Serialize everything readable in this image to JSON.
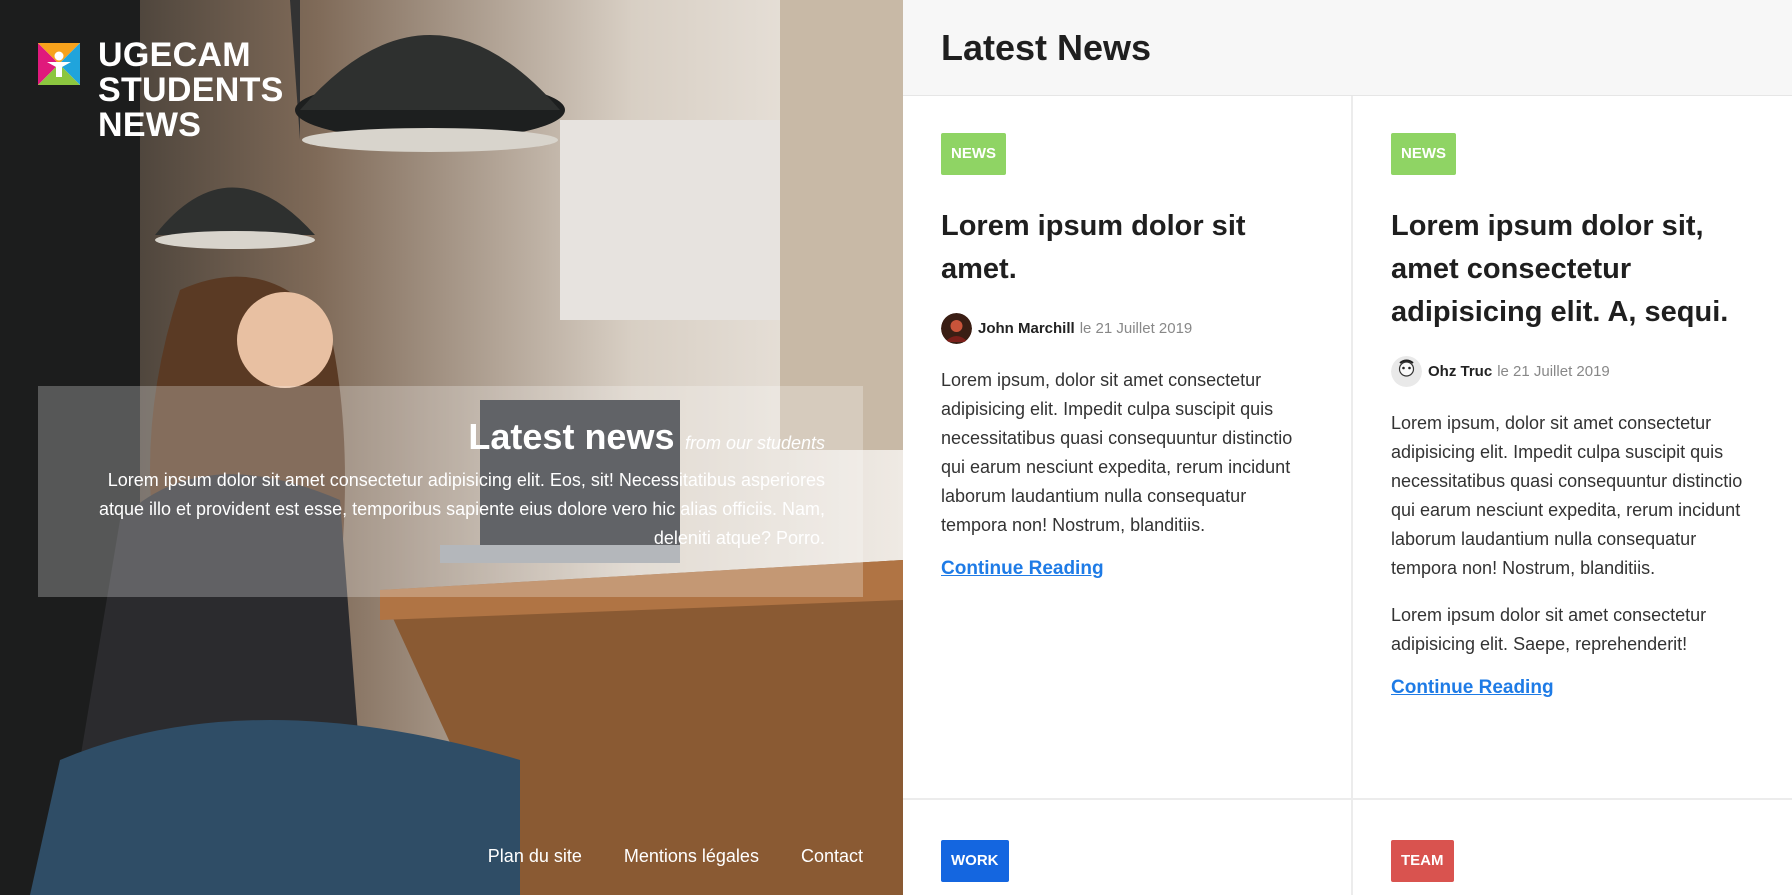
{
  "brand": {
    "lines": [
      "UGECAM",
      "STUDENTS",
      "NEWS"
    ]
  },
  "hero": {
    "title": "Latest news",
    "subtitle": "from our students",
    "text": "Lorem ipsum dolor sit amet consectetur adipisicing elit. Eos, sit! Necessitatibus asperiores atque illo et provident est esse, temporibus sapiente eius dolore vero hic alias officiis. Nam, deleniti atque? Porro."
  },
  "footer": {
    "links": [
      "Plan du site",
      "Mentions légales",
      "Contact"
    ]
  },
  "panel": {
    "title": "Latest News",
    "cards": [
      {
        "badge": "NEWS",
        "badge_color": "#8fd464",
        "title": "Lorem ipsum dolor sit amet.",
        "author": "John Marchill",
        "date": "le 21 Juillet 2019",
        "paragraphs": [
          "Lorem ipsum, dolor sit amet consectetur adipisicing elit. Impedit culpa suscipit quis necessitatibus quasi consequuntur distinctio qui earum nesciunt expedita, rerum incidunt laborum laudantium nulla consequatur tempora non! Nostrum, blanditiis."
        ],
        "link": "Continue Reading"
      },
      {
        "badge": "NEWS",
        "badge_color": "#8fd464",
        "title": "Lorem ipsum dolor sit, amet consectetur adipisicing elit. A, sequi.",
        "author": "Ohz Truc",
        "date": "le 21 Juillet 2019",
        "paragraphs": [
          "Lorem ipsum, dolor sit amet consectetur adipisicing elit. Impedit culpa suscipit quis necessitatibus quasi consequuntur distinctio qui earum nesciunt expedita, rerum incidunt laborum laudantium nulla consequatur tempora non! Nostrum, blanditiis.",
          "Lorem ipsum dolor sit amet consectetur adipisicing elit. Saepe, reprehenderit!"
        ],
        "link": "Continue Reading"
      },
      {
        "badge": "WORK",
        "badge_color": "#1466e0"
      },
      {
        "badge": "TEAM",
        "badge_color": "#d9534f"
      }
    ]
  },
  "colors": {
    "link": "#1e7be6",
    "header_bg": "#f7f7f7"
  }
}
